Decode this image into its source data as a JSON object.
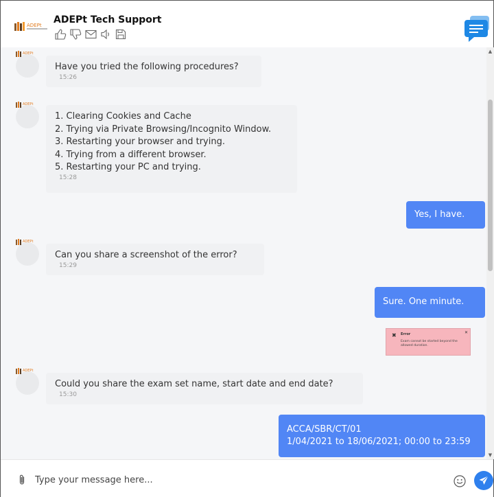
{
  "header": {
    "title": "ADEPt Tech Support",
    "logo_text": "ADEPt",
    "icons": [
      "thumbs-up-icon",
      "thumbs-down-icon",
      "mail-icon",
      "speaker-icon",
      "save-icon"
    ],
    "chat_icon": "chat-bubble-icon"
  },
  "messages": [
    {
      "from": "agent",
      "text": "Have you tried the following procedures?",
      "time": "15:26"
    },
    {
      "from": "agent",
      "lines": [
        "1. Clearing Cookies and Cache",
        "2. Trying via Private Browsing/Incognito Window.",
        "3. Restarting your browser and trying.",
        "4. Trying from a different browser.",
        "5. Restarting your PC and trying."
      ],
      "time": "15:28"
    },
    {
      "from": "user",
      "text": "Yes, I have."
    },
    {
      "from": "agent",
      "text": "Can you share a screenshot of the error?",
      "time": "15:29"
    },
    {
      "from": "user",
      "text": "Sure. One minute."
    },
    {
      "from": "user",
      "attachment": {
        "title": "Error",
        "message": "Exam cannot be started beyond the allowed duration."
      }
    },
    {
      "from": "agent",
      "text": "Could you share the exam set name, start date and end date?",
      "time": "15:30"
    },
    {
      "from": "user",
      "lines": [
        "ACCA/SBR/CT/01",
        "1/04/2021 to 18/06/2021; 00:00 to 23:59"
      ]
    }
  ],
  "input": {
    "placeholder": "Type your message here...",
    "value": ""
  },
  "colors": {
    "user_bubble": "#5186f5",
    "agent_bubble": "#f0f1f3",
    "send_button": "#2f80ed",
    "chat_icon": "#1e88e5"
  }
}
